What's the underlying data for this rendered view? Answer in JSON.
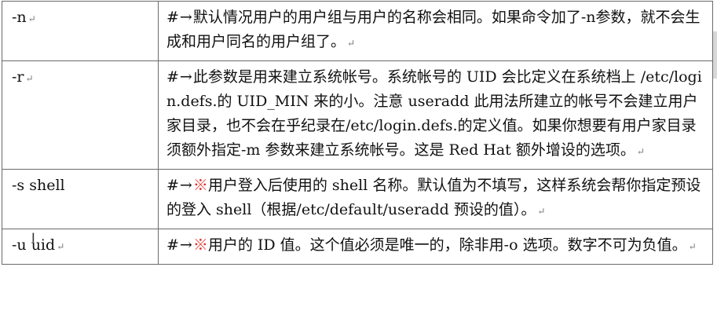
{
  "rows": [
    {
      "option": "-n",
      "prefix": "#",
      "arrow": "→",
      "star": "",
      "text": "默认情况用户的用户组与用户的名称会相同。如果命令加了-n参数，就不会生成和用户同名的用户组了。"
    },
    {
      "option": "-r",
      "prefix": "#",
      "arrow": "→",
      "star": "",
      "text": "此参数是用来建立系统帐号。系统帐号的 UID 会比定义在系统档上 /etc/login.defs.的 UID_MIN 来的小。注意 useradd 此用法所建立的帐号不会建立用户家目录，也不会在乎纪录在/etc/login.defs.的定义值。如果你想要有用户家目录须额外指定-m 参数来建立系统帐号。这是 Red Hat 额外增设的选项。"
    },
    {
      "option": "-s shell",
      "prefix": "#",
      "arrow": "→",
      "star": "※",
      "text": "用户登入后使用的 shell 名称。默认值为不填写，这样系统会帮你指定预设的登入 shell（根据/etc/default/useradd 预设的值）。"
    },
    {
      "option": "-u uid",
      "prefix": "#",
      "arrow": "→",
      "star": "※",
      "text": "用户的 ID 值。这个值必须是唯一的，除非用-o 选项。数字不可为负值。"
    }
  ],
  "paragraph_mark": "↵",
  "cursor_glyph": "I"
}
